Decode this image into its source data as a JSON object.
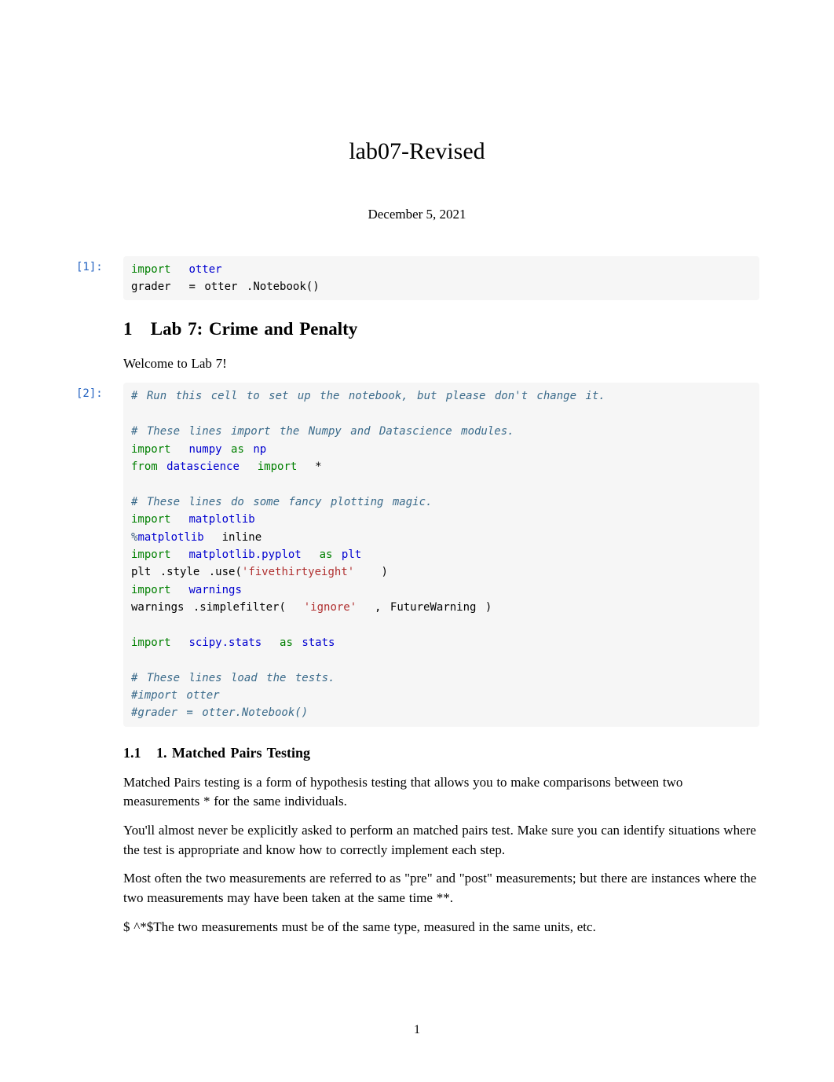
{
  "title": "lab07-Revised",
  "date": "December 5, 2021",
  "cells": {
    "c1": {
      "prompt": "[1]:",
      "code": {
        "l1_import": "import",
        "l1_mod": "otter",
        "l2_a": "grader ",
        "l2_eq": "=",
        "l2_b": " otter",
        "l2_dot": ".",
        "l2_c": "Notebook()"
      }
    },
    "h1_num": "1",
    "h1_text": "Lab 7: Crime and Penalty",
    "welcome": "Welcome to Lab 7!",
    "c2": {
      "prompt": "[2]:",
      "code": {
        "l1": "# Run this cell to set up the notebook, but please don't change it.",
        "l3": "# These lines import the Numpy and Datascience modules.",
        "l4_import": "import",
        "l4_mod": "numpy",
        "l4_as": "as",
        "l4_alias": "np",
        "l5_from": "from",
        "l5_mod": "datascience",
        "l5_import": "import",
        "l5_star": "*",
        "l7": "# These lines do some fancy plotting magic.",
        "l8_import": "import",
        "l8_mod": "matplotlib",
        "l9_magic": "%",
        "l9_cmd": "matplotlib",
        "l9_arg": "inline",
        "l10_import": "import",
        "l10_mod": "matplotlib.pyplot",
        "l10_as": "as",
        "l10_alias": "plt",
        "l11_a": "plt",
        "l11_b": "style",
        "l11_c": "use(",
        "l11_str": "'fivethirtyeight'",
        "l11_d": ")",
        "l12_import": "import",
        "l12_mod": "warnings",
        "l13_a": "warnings",
        "l13_b": "simplefilter(",
        "l13_str": "'ignore'",
        "l13_c": ", FutureWarning )",
        "l15_import": "import",
        "l15_mod": "scipy.stats",
        "l15_as": "as",
        "l15_alias": "stats",
        "l17": "# These lines load the tests.",
        "l18": "#import otter",
        "l19": "#grader = otter.Notebook()"
      }
    },
    "h2_num": "1.1",
    "h2_text": "1. Matched Pairs Testing",
    "p1": "Matched Pairs testing is a form of hypothesis testing that allows you to make comparisons between two measurements * for the same individuals.",
    "p2": "You'll almost never be explicitly asked to perform an matched pairs test. Make sure you can identify situations where the test is appropriate and know how to correctly implement each step.",
    "p3": "Most often the two measurements are referred to as \"pre\" and \"post\" measurements; but there are instances where the two measurements may have been taken at the same time **.",
    "p4": "$ ^*$The two measurements must be of the same type, measured in the same units, etc.",
    "page": "1"
  }
}
